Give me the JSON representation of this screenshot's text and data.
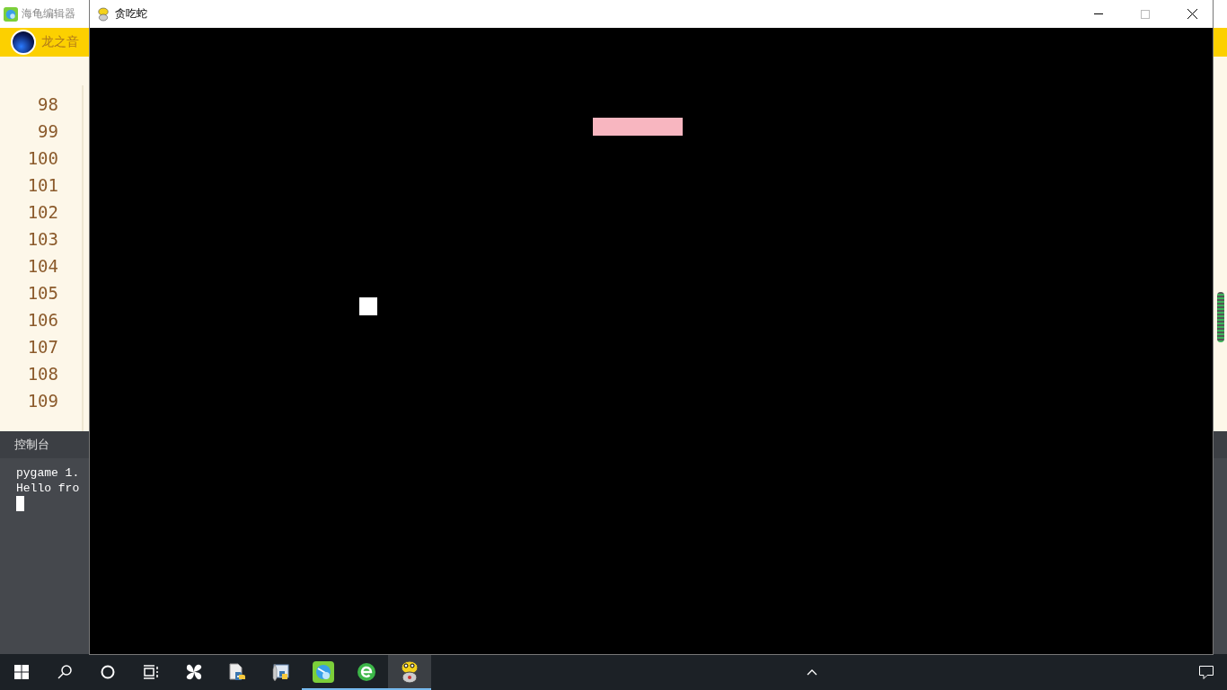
{
  "editor_window": {
    "title": "海龟编辑器",
    "user_name": "龙之音",
    "line_numbers": [
      "98",
      "99",
      "100",
      "101",
      "102",
      "103",
      "104",
      "105",
      "106",
      "107",
      "108",
      "109"
    ],
    "console": {
      "title": "控制台",
      "lines": [
        "pygame 1.",
        "Hello fro"
      ]
    }
  },
  "game_window": {
    "title": "贪吃蛇"
  },
  "taskbar": {
    "apps": [
      {
        "kind": "start",
        "selected": false,
        "running": false
      },
      {
        "kind": "search",
        "selected": false,
        "running": false
      },
      {
        "kind": "cortana",
        "selected": false,
        "running": false
      },
      {
        "kind": "taskview",
        "selected": false,
        "running": false
      },
      {
        "kind": "pinwheel",
        "selected": false,
        "running": false
      },
      {
        "kind": "pyfile",
        "selected": false,
        "running": false
      },
      {
        "kind": "pylauncher",
        "selected": false,
        "running": false
      },
      {
        "kind": "turtle",
        "selected": false,
        "running": true
      },
      {
        "kind": "browser",
        "selected": false,
        "running": true
      },
      {
        "kind": "pygame",
        "selected": true,
        "running": true
      }
    ]
  }
}
